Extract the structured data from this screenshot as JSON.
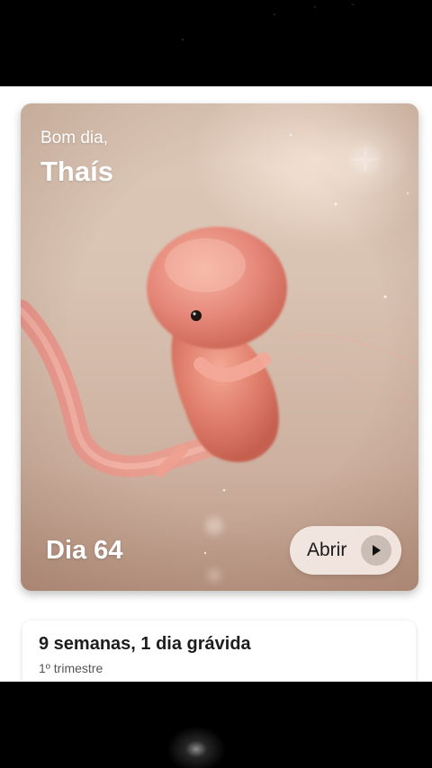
{
  "hero": {
    "greeting": "Bom dia,",
    "name": "Thaís",
    "day_label": "Dia 64",
    "open_button_label": "Abrir",
    "image_icon": "embryo-illustration",
    "play_icon": "play-icon"
  },
  "pregnancy": {
    "title": "9 semanas, 1 dia grávida",
    "trimester": "1º trimestre"
  },
  "colors": {
    "card_background": "#d9c3b3",
    "embryo": "#e48876",
    "button_background": "#f5ece6",
    "text_dark": "#1d1d1d"
  }
}
